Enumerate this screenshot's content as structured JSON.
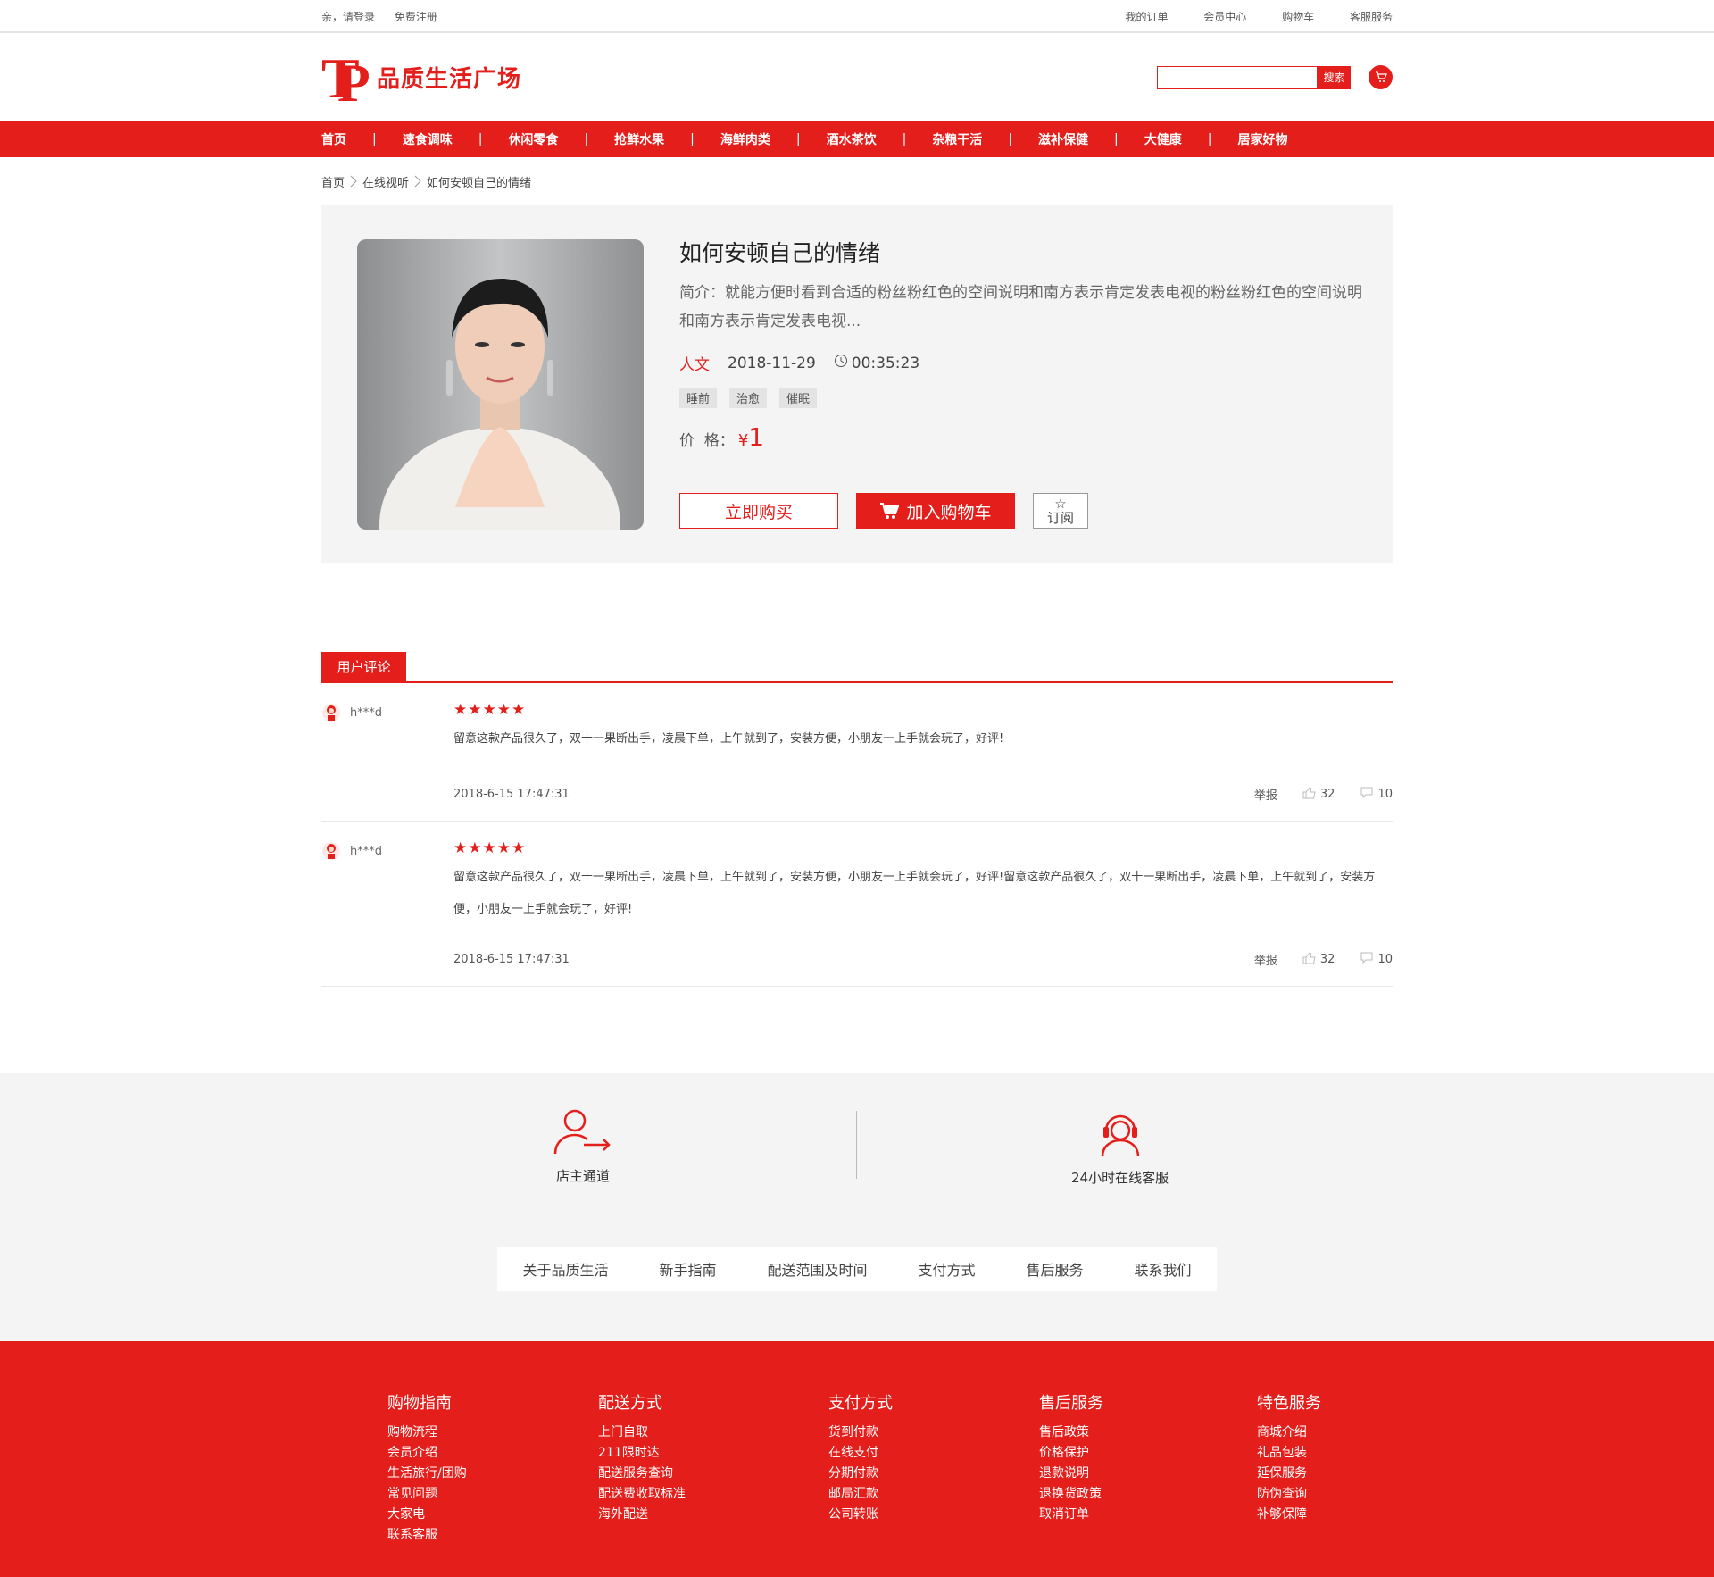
{
  "topbar": {
    "login": "亲，请登录",
    "register": "免费注册",
    "links": [
      "我的订单",
      "会员中心",
      "购物车",
      "客服服务"
    ]
  },
  "header": {
    "logo_text": "品质生活广场",
    "search_button": "搜索"
  },
  "nav": {
    "items": [
      "首页",
      "速食调味",
      "休闲零食",
      "抢鲜水果",
      "海鲜肉类",
      "酒水茶饮",
      "杂粮干活",
      "滋补保健",
      "大健康",
      "居家好物"
    ]
  },
  "breadcrumb": [
    "首页",
    "在线视听",
    "如何安顿自己的情绪"
  ],
  "product": {
    "title": "如何安顿自己的情绪",
    "description": "简介：就能方便时看到合适的粉丝粉红色的空间说明和南方表示肯定发表电视的粉丝粉红色的空间说明和南方表示肯定发表电视...",
    "category": "人文",
    "date": "2018-11-29",
    "duration": "00:35:23",
    "tags": [
      "睡前",
      "治愈",
      "催眠"
    ],
    "price_label": "价  格：",
    "currency": "¥",
    "price": "1",
    "buy_label": "立即购买",
    "cart_label": "加入购物车",
    "subscribe_label": "订阅"
  },
  "comments": {
    "tab_label": "用户评论",
    "items": [
      {
        "user": "h***d",
        "rating": 5,
        "text": "留意这款产品很久了，双十一果断出手，凌晨下单，上午就到了，安装方便，小朋友一上手就会玩了，好评!",
        "time": "2018-6-15 17:47:31",
        "report": "举报",
        "likes": "32",
        "replies": "10"
      },
      {
        "user": "h***d",
        "rating": 5,
        "text": "留意这款产品很久了，双十一果断出手，凌晨下单，上午就到了，安装方便，小朋友一上手就会玩了，好评!留意这款产品很久了，双十一果断出手，凌晨下单，上午就到了，安装方便，小朋友一上手就会玩了，好评!",
        "time": "2018-6-15 17:47:31",
        "report": "举报",
        "likes": "32",
        "replies": "10"
      }
    ]
  },
  "services": {
    "owner": "店主通道",
    "support": "24小时在线客服",
    "links": [
      "关于品质生活",
      "新手指南",
      "配送范围及时间",
      "支付方式",
      "售后服务",
      "联系我们"
    ]
  },
  "footer": {
    "columns": [
      {
        "title": "购物指南",
        "items": [
          "购物流程",
          "会员介绍",
          "生活旅行/团购",
          "常见问题",
          "大家电",
          "联系客服"
        ]
      },
      {
        "title": "配送方式",
        "items": [
          "上门自取",
          "211限时达",
          "配送服务查询",
          "配送费收取标准",
          "海外配送"
        ]
      },
      {
        "title": "支付方式",
        "items": [
          "货到付款",
          "在线支付",
          "分期付款",
          "邮局汇款",
          "公司转账"
        ]
      },
      {
        "title": "售后服务",
        "items": [
          "售后政策",
          "价格保护",
          "退款说明",
          "退换货政策",
          "取消订单"
        ]
      },
      {
        "title": "特色服务",
        "items": [
          "商城介绍",
          "礼品包装",
          "延保服务",
          "防伪查询",
          "补够保障"
        ]
      }
    ]
  },
  "colors": {
    "brand": "#e41e1b",
    "panel": "#f4f4f4"
  },
  "icons": [
    "logo-mark-icon",
    "cart-icon",
    "chevron-right-icon",
    "clock-icon",
    "star-outline-icon",
    "star-icon",
    "like-icon",
    "reply-icon",
    "user-arrow-icon",
    "headset-icon"
  ]
}
